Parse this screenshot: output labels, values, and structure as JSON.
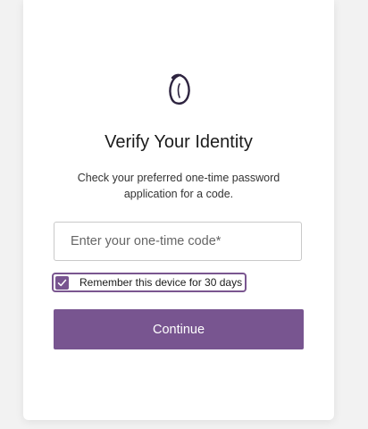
{
  "logo": {
    "icon": "brand-logo-icon"
  },
  "title": "Verify Your Identity",
  "subtitle": "Check your preferred one-time password application for a code.",
  "code_input": {
    "placeholder": "Enter your one-time code*",
    "value": ""
  },
  "remember": {
    "label": "Remember this device for 30 days",
    "checked": true,
    "icon": "checkmark-icon"
  },
  "continue_label": "Continue",
  "colors": {
    "accent": "#785590",
    "background": "#f2f2f2",
    "card": "#ffffff"
  }
}
